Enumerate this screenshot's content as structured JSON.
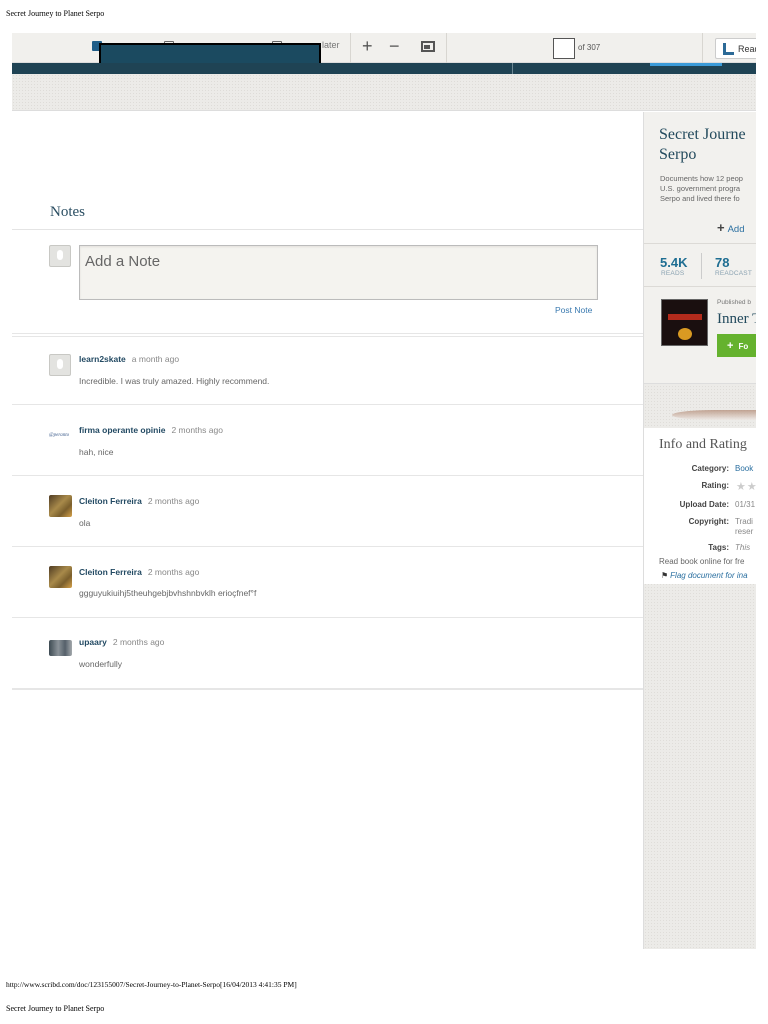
{
  "print": {
    "header_title": "Secret Journey to Planet Serpo",
    "footer_url": "http://www.scribd.com/doc/123155007/Secret-Journey-to-Planet-Serpo[16/04/2013 4:41:35 PM]",
    "footer_title": "Secret Journey to Planet Serpo"
  },
  "toolbar": {
    "read_later_label": "later",
    "zoom_in": "+",
    "zoom_out": "−",
    "page_current": "",
    "page_total_label": "of 307",
    "read_button_label": "Read"
  },
  "notes": {
    "title": "Notes",
    "input_placeholder": "Add a Note",
    "post_label": "Post Note",
    "comments": [
      {
        "user": "learn2skate",
        "time": "a month ago",
        "text": "Incredible. I was truly amazed. Highly recommend.",
        "avatar": "default"
      },
      {
        "user": "firma operante opinie",
        "time": "2 months ago",
        "text": "hah, nice",
        "avatar": "logo"
      },
      {
        "user": "Cleiton Ferreira",
        "time": "2 months ago",
        "text": "ola",
        "avatar": "photo"
      },
      {
        "user": "Cleiton Ferreira",
        "time": "2 months ago",
        "text": "ggguyukiuihj5theuhgebjbvhshnbvklh erioçfnef°f",
        "avatar": "photo"
      },
      {
        "user": "upaary",
        "time": "2 months ago",
        "text": "wonderfully",
        "avatar": "photo"
      }
    ]
  },
  "sidebar": {
    "title_line1": "Secret Journe",
    "title_line2": "Serpo",
    "desc_line1": "Documents how 12 peop",
    "desc_line2": "U.S. government progra",
    "desc_line3": "Serpo and lived there fo",
    "add_label": "Add",
    "reads_value": "5.4K",
    "reads_label": "READS",
    "readcasts_value": "78",
    "readcasts_label": "READCAST",
    "published_label": "Published b",
    "publisher_name": "Inner T",
    "follow_label": "Fo"
  },
  "info": {
    "title": "Info and Rating",
    "category_key": "Category:",
    "category_val": "Book",
    "rating_key": "Rating:",
    "rating_stars": "★★",
    "upload_key": "Upload Date:",
    "upload_val": "01/31",
    "copyright_key": "Copyright:",
    "copyright_val1": "Tradi",
    "copyright_val2": "reser",
    "tags_key": "Tags:",
    "tags_val": "This",
    "read_free": "Read book online for fre",
    "flag_label": "Flag document for ina"
  },
  "colors": {
    "accent": "#234a63",
    "link": "#2a6fa0",
    "follow_green": "#65b22e",
    "navbar": "#1f4354"
  }
}
